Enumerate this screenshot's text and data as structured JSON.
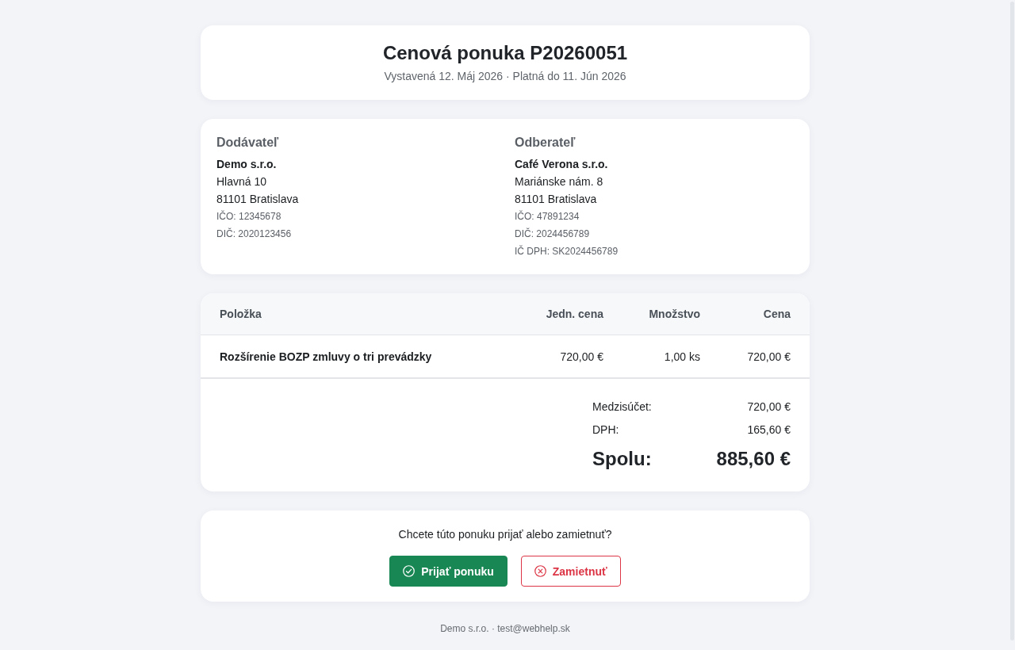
{
  "header": {
    "title": "Cenová ponuka P20260051",
    "subtitle": "Vystavená 12. Máj 2026 · Platná do 11. Jún 2026"
  },
  "parties": [
    {
      "heading": "Dodávateľ",
      "name": "Demo s.r.o.",
      "address": [
        "Hlavná 10",
        "81101 Bratislava"
      ],
      "ids": [
        "IČO: 12345678",
        "DIČ: 2020123456"
      ]
    },
    {
      "heading": "Odberateľ",
      "name": "Café Verona s.r.o.",
      "address": [
        "Mariánske nám. 8",
        "81101 Bratislava"
      ],
      "ids": [
        "IČO: 47891234",
        "DIČ: 2024456789",
        "IČ DPH: SK2024456789"
      ]
    }
  ],
  "table": {
    "columns": [
      "Položka",
      "Jedn. cena",
      "Množstvo",
      "Cena"
    ],
    "rows": [
      {
        "cells": [
          "Rozšírenie BOZP zmluvy o tri prevádzky",
          "720,00 €",
          "1,00 ks",
          "720,00 €"
        ]
      }
    ]
  },
  "totals": [
    {
      "kind": "line",
      "label": "Medzisúčet:",
      "value": "720,00 €"
    },
    {
      "kind": "line",
      "label": "DPH:",
      "value": "165,60 €"
    },
    {
      "kind": "grand",
      "label": "Spolu:",
      "value": "885,60 €"
    }
  ],
  "decision": {
    "question": "Chcete túto ponuku prijať alebo zamietnuť?",
    "buttons": [
      {
        "kind": "accept",
        "label": "Prijať ponuku"
      },
      {
        "kind": "reject",
        "label": "Zamietnuť"
      }
    ]
  },
  "footer": "Demo s.r.o. · test@webhelp.sk"
}
